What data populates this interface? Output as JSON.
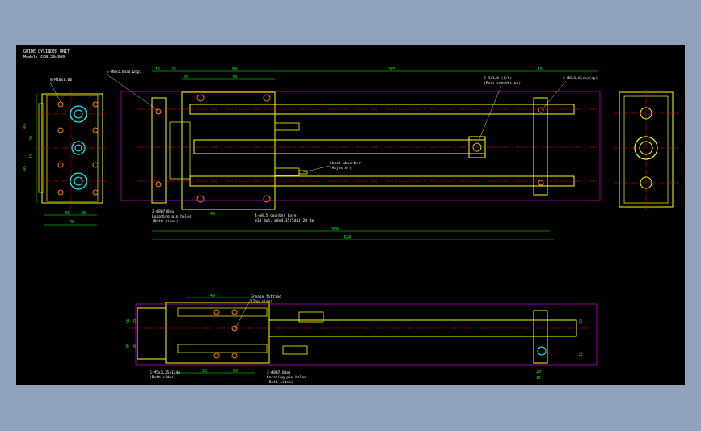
{
  "title": {
    "line1": "GUIDE CYLINDER UNIT",
    "line2": "Model: CGB 20x300"
  },
  "colors": {
    "background": "#000000",
    "frame_bg": "#8fa2b9",
    "outline": "#ffff00",
    "dimension": "#00ff00",
    "centerline": "#ff0000",
    "part": "#ff00ff",
    "detail": "#00ffff",
    "annot": "#ffffff",
    "fastener": "#ff8000"
  },
  "dims_top": {
    "d15a": "15",
    "d80": "80",
    "d375": "375",
    "d15b": "15",
    "d25": "25",
    "d70": "70",
    "d20": "20"
  },
  "dims_mid": {
    "d300": "300",
    "d424": "424",
    "d45": "45"
  },
  "dims_left": {
    "d45": "45",
    "d38": "38",
    "d19": "19",
    "d38b": "38",
    "d36": "36",
    "d45b": "45",
    "d70": "70"
  },
  "dims_bottom": {
    "d40": "40",
    "d25": "25",
    "d60": "60",
    "d22": "22",
    "d20": "20",
    "d15": "15",
    "d24": "24",
    "d28": "28",
    "d30": "30",
    "d35": "35",
    "d16": "16"
  },
  "callouts": {
    "c1": "4-M8x1.0pa(12dp)",
    "c2": "2-Rc1/8 (1/8)",
    "c2b": "(Port connection)",
    "c3": "3-M8x1.0(ea)(dp)",
    "c4": "2-Ø8H7(8dp)",
    "c4b": "Locating pin holes",
    "c4c": "(Both sides)",
    "c5": "4-ø8.5 counter bore",
    "c5b": "ø14 dp5, ø8x4.35(5dp) 20 dp",
    "c6": "Shock absorber",
    "c6b": "(Adjuster)",
    "c7": "8-M10x1.0b",
    "c8": "Grease fitting",
    "c8b": "(Top side)",
    "c9": "6-M5x1.25x12dp",
    "c9b": "(Both sides)",
    "c10": "2-Ø8H7(8dp)",
    "c10b": "Locating pin holes",
    "c10c": "(Both sides)"
  }
}
